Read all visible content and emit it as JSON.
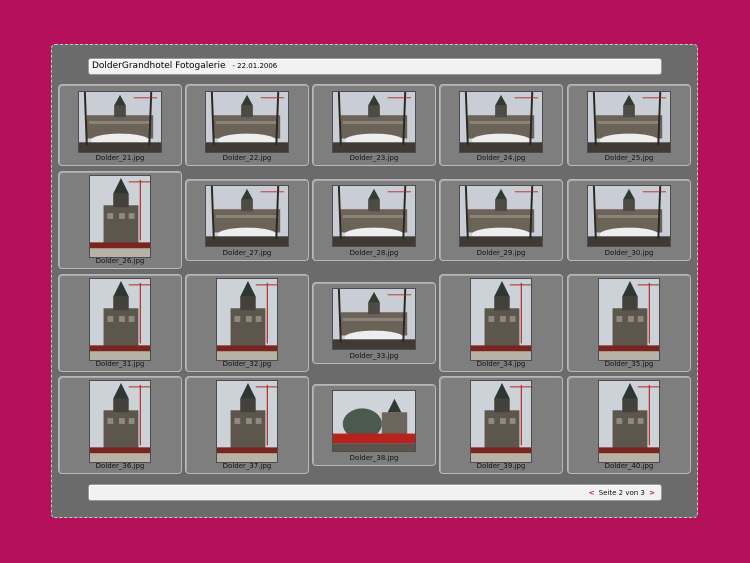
{
  "header": {
    "title": "DolderGrandhotel Fotogalerie",
    "date": "- 22.01.2006"
  },
  "gallery": {
    "items": [
      {
        "caption": "Dolder_21.jpg"
      },
      {
        "caption": "Dolder_22.jpg"
      },
      {
        "caption": "Dolder_23.jpg"
      },
      {
        "caption": "Dolder_24.jpg"
      },
      {
        "caption": "Dolder_25.jpg"
      },
      {
        "caption": "Dolder_26.jpg"
      },
      {
        "caption": "Dolder_27.jpg"
      },
      {
        "caption": "Dolder_28.jpg"
      },
      {
        "caption": "Dolder_29.jpg"
      },
      {
        "caption": "Dolder_30.jpg"
      },
      {
        "caption": "Dolder_31.jpg"
      },
      {
        "caption": "Dolder_32.jpg"
      },
      {
        "caption": "Dolder_33.jpg"
      },
      {
        "caption": "Dolder_34.jpg"
      },
      {
        "caption": "Dolder_35.jpg"
      },
      {
        "caption": "Dolder_36.jpg"
      },
      {
        "caption": "Dolder_37.jpg"
      },
      {
        "caption": "Dolder_38.jpg"
      },
      {
        "caption": "Dolder_39.jpg"
      },
      {
        "caption": "Dolder_40.jpg"
      }
    ]
  },
  "pagination": {
    "prev_symbol": "<",
    "label": "Seite 2 von 3",
    "next_symbol": ">"
  },
  "colors": {
    "background": "#b5105a",
    "panel": "#6b6b6b",
    "card": "#7e7e7e",
    "accent": "#b5105a"
  }
}
